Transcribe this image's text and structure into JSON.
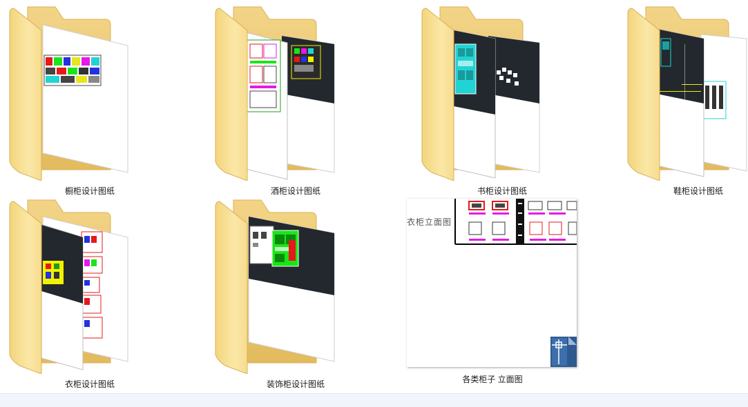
{
  "folders": [
    {
      "name": "橱柜设计图纸",
      "icon": "folder-icon"
    },
    {
      "name": "酒柜设计图纸",
      "icon": "folder-icon"
    },
    {
      "name": "书柜设计图纸",
      "icon": "folder-icon"
    },
    {
      "name": "鞋柜设计图纸",
      "icon": "folder-icon"
    },
    {
      "name": "衣柜设计图纸",
      "icon": "folder-icon"
    },
    {
      "name": "装饰柜设计图纸",
      "icon": "folder-icon"
    }
  ],
  "file": {
    "name": "各类柜子  立面图",
    "preview_title": "衣柜立面图",
    "icon": "autocad-dwg-icon"
  },
  "colors": {
    "folder_back": "#e9c670",
    "folder_front": "#f7dd8c",
    "folder_edge": "#d9b155",
    "cad_dark": "#23282e",
    "cad_cyan": "#22d3d3",
    "cad_yellow": "#f2f200",
    "cad_green": "#19e619",
    "cad_red": "#e61919",
    "cad_magenta": "#e619e6"
  }
}
